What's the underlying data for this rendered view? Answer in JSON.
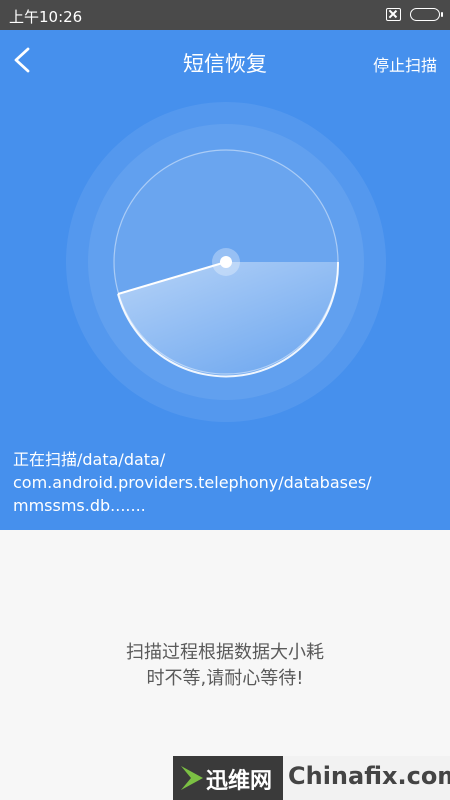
{
  "status_bar": {
    "time": "上午10:26",
    "icons": [
      "sim-card-absent-icon",
      "battery-icon"
    ]
  },
  "header": {
    "back_icon": "chevron-left-icon",
    "title": "短信恢复",
    "stop_button_label": "停止扫描"
  },
  "scan": {
    "state": "scanning",
    "path_lines": [
      "正在扫描/data/data/",
      "com.android.providers.telephony/databases/",
      "mmssms.db......."
    ]
  },
  "hint": {
    "lines": [
      "扫描过程根据数据大小耗",
      "时不等,请耐心等待!"
    ]
  },
  "watermark": {
    "brand_cn": "迅维网",
    "brand_en": "Chinafix.com"
  },
  "colors": {
    "accent": "#4690ed",
    "status_bar": "#4a4a4a",
    "background": "#f7f7f7",
    "hint_text": "#5a5a5a"
  }
}
